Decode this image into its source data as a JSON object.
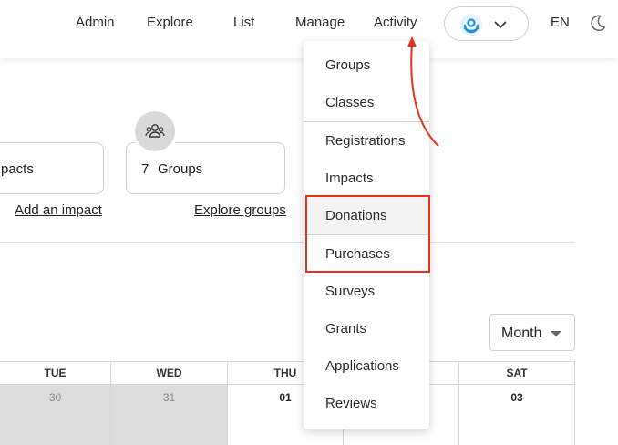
{
  "header": {
    "nav": [
      "Admin",
      "Explore",
      "List",
      "Manage",
      "Activity"
    ],
    "lang": "EN"
  },
  "cards": {
    "impacts_text": "pacts",
    "impacts_link": "Add an impact",
    "groups_count": "7",
    "groups_text": "Groups",
    "groups_link": "Explore groups"
  },
  "month_select": {
    "value": "Month"
  },
  "calendar": {
    "days": [
      "TUE",
      "WED",
      "THU",
      "",
      "SAT"
    ],
    "dates": [
      "30",
      "31",
      "01",
      "",
      "03"
    ]
  },
  "dropdown": {
    "items": [
      "Groups",
      "Classes",
      "Registrations",
      "Impacts",
      "Donations",
      "Purchases",
      "Surveys",
      "Grants",
      "Applications",
      "Reviews"
    ]
  },
  "colors": {
    "highlight": "#e5321f",
    "logo": "#1f8fd6"
  }
}
